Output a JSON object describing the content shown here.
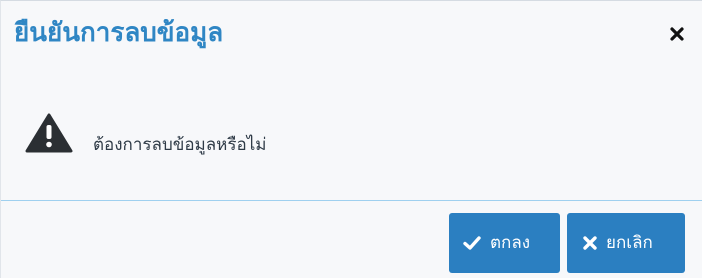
{
  "dialog": {
    "title": "ยืนยันการลบข้อมูล",
    "close_icon": "close-icon",
    "warning_icon": "warning-triangle-icon",
    "message": "ต้องการลบข้อมูลหรือไม่",
    "ok_button": {
      "label": "ตกลง",
      "icon": "check-icon"
    },
    "cancel_button": {
      "label": "ยกเลิก",
      "icon": "times-icon"
    }
  },
  "colors": {
    "title": "#2f86c4",
    "button_background": "#2b7fc1",
    "button_text": "#ffffff",
    "dialog_background": "#f7f8fa",
    "divider": "#9fd0ef",
    "warning_icon": "#2b2f33"
  }
}
